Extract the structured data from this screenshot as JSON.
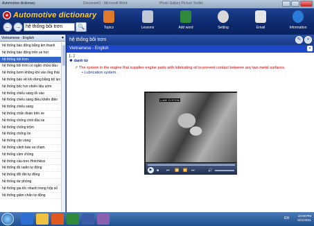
{
  "window": {
    "title": "Automotive dictionary",
    "center_title": "Document1 - Microsoft Word",
    "center_title2": "Photo Gallery    Picture Toolkit"
  },
  "header": {
    "logo": "Automotive dictionary",
    "search_value": "hệ thống bôi trơn",
    "tools": [
      {
        "label": "Topics",
        "icon": "book-icon",
        "color": "#e07a2a"
      },
      {
        "label": "Lessons",
        "icon": "building-icon",
        "color": "#c0c8d8"
      },
      {
        "label": "Add word",
        "icon": "notebook-icon",
        "color": "#2f8a3c"
      },
      {
        "label": "Setting",
        "icon": "gear-icon",
        "color": "#d8d8d8"
      },
      {
        "label": "Email",
        "icon": "envelope-icon",
        "color": "#e6e6e6"
      },
      {
        "label": "Information",
        "icon": "info-icon",
        "color": "#2a7ad8"
      }
    ]
  },
  "left": {
    "language": "Vietnamese - English",
    "items": [
      "hệ thống báo động bằng âm thanh",
      "hệ thống báo động trên xe hơi",
      "hệ thống bôi trơn",
      "hệ thống bôi trơn có ngăn chứa dầu",
      "hệ thống bơm không khí vào ống thải",
      "hệ thống báo vệ khi dừng bằng bộ lực",
      "hệ thống bốc hơi nhiên liệu sớm",
      "hệ thống chiếu sáng lối vào",
      "hệ thống chiếu sáng điều khiển điện",
      "hệ thống chiếu sáng",
      "hệ thống chẩn đoán trên xe",
      "hệ thống chống chói đầu xe",
      "hệ thống chống trộm",
      "hệ thống chống ồn",
      "hệ thống cân vàng",
      "hệ thống cảnh báo va chạm",
      "hệ thống cảm chồng",
      "hệ thống cầu-treo Hotchkiss",
      "hệ thống đồ radio tự động",
      "hệ thống đổi đèi tự động",
      "hệ thống dư phòng",
      "hệ thống gia tốc nhanh trong hộp số",
      "hệ thống giảm chấn tự động"
    ],
    "selected_index": 2
  },
  "right": {
    "title": "hệ thống bôi trơn",
    "langbar": "Vietnamese - English",
    "pron": "[...]",
    "pos": "danh từ",
    "definition": "The system in the engine that supplies engine parts with lubricating oil to prevent contact between any two metal surfaces.",
    "example": "Lubrication system .",
    "video_label": "LUBE SYSTEM"
  },
  "taskbar": {
    "time": "10:08 PM",
    "date": "6/21/2011",
    "tray": "EN"
  }
}
